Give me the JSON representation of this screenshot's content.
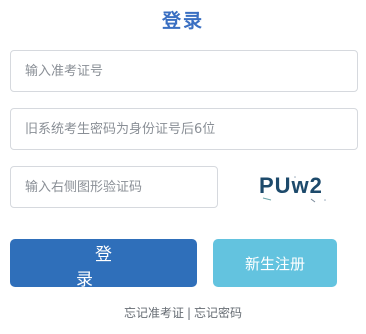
{
  "title": "登录",
  "form": {
    "ticket_placeholder": "输入准考证号",
    "password_placeholder": "旧系统考生密码为身份证号后6位",
    "captcha_placeholder": "输入右侧图形验证码",
    "captcha_text": "PUw2"
  },
  "buttons": {
    "login": "登 录",
    "register": "新生注册"
  },
  "links": {
    "forgot_ticket": "忘记准考证",
    "separator": "|",
    "forgot_password": "忘记密码"
  },
  "colors": {
    "title": "#3a6fc2",
    "login_button": "#2f6fba",
    "register_button": "#63c3df",
    "captcha_text": "#1d4a6b"
  }
}
